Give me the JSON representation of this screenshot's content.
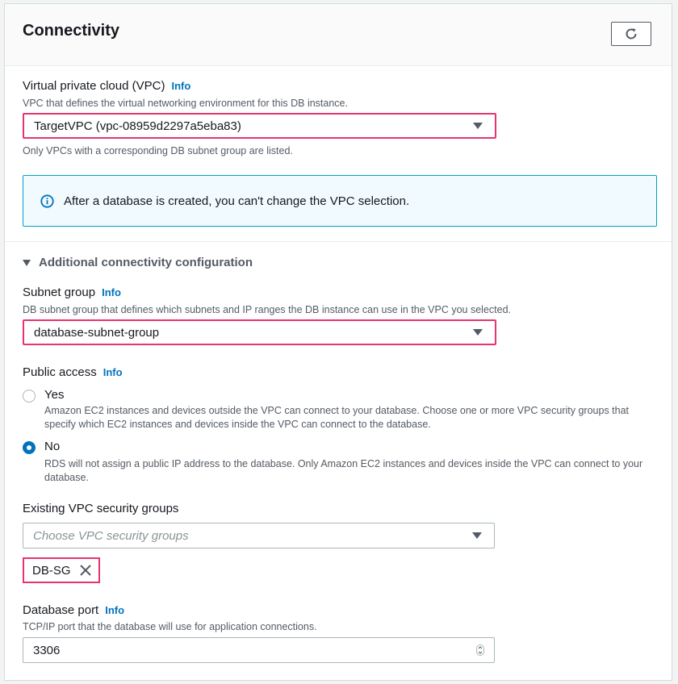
{
  "panel": {
    "title": "Connectivity"
  },
  "vpc": {
    "label": "Virtual private cloud (VPC)",
    "info": "Info",
    "description": "VPC that defines the virtual networking environment for this DB instance.",
    "selected": "TargetVPC (vpc-08959d2297a5eba83)",
    "hint": "Only VPCs with a corresponding DB subnet group are listed."
  },
  "alert": {
    "text": "After a database is created, you can't change the VPC selection."
  },
  "additional": {
    "label": "Additional connectivity configuration"
  },
  "subnet": {
    "label": "Subnet group",
    "info": "Info",
    "description": "DB subnet group that defines which subnets and IP ranges the DB instance can use in the VPC you selected.",
    "selected": "database-subnet-group"
  },
  "public_access": {
    "label": "Public access",
    "info": "Info",
    "yes_label": "Yes",
    "yes_desc": "Amazon EC2 instances and devices outside the VPC can connect to your database. Choose one or more VPC security groups that specify which EC2 instances and devices inside the VPC can connect to the database.",
    "no_label": "No",
    "no_desc": "RDS will not assign a public IP address to the database. Only Amazon EC2 instances and devices inside the VPC can connect to your database.",
    "selected": "No"
  },
  "security_groups": {
    "label": "Existing VPC security groups",
    "placeholder": "Choose VPC security groups",
    "tokens": [
      "DB-SG"
    ]
  },
  "port": {
    "label": "Database port",
    "info": "Info",
    "description": "TCP/IP port that the database will use for application connections.",
    "value": "3306"
  },
  "colors": {
    "accent": "#0073bb",
    "highlight": "#e8336d",
    "alert_border": "#00a1c9",
    "alert_bg": "#f1faff"
  },
  "icons": [
    "refresh-icon",
    "info-circle-icon",
    "caret-down-icon",
    "close-icon",
    "spinner-icon"
  ]
}
